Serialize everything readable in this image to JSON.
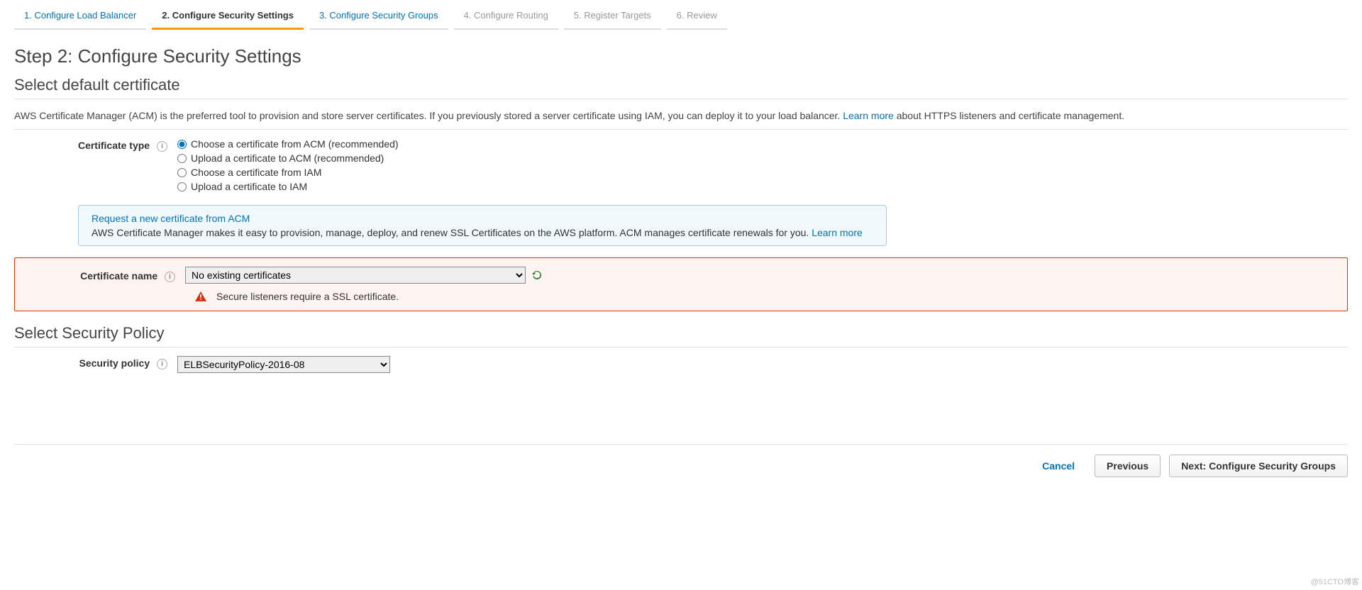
{
  "wizard": {
    "steps": [
      "1. Configure Load Balancer",
      "2. Configure Security Settings",
      "3. Configure Security Groups",
      "4. Configure Routing",
      "5. Register Targets",
      "6. Review"
    ]
  },
  "titles": {
    "page": "Step 2: Configure Security Settings",
    "section_cert": "Select default certificate",
    "section_policy": "Select Security Policy"
  },
  "cert_desc": {
    "text_a": "AWS Certificate Manager (ACM) is the preferred tool to provision and store server certificates. If you previously stored a server certificate using IAM, you can deploy it to your load balancer. ",
    "learn_more": "Learn more",
    "text_b": " about HTTPS listeners and certificate management."
  },
  "labels": {
    "certificate_type": "Certificate type",
    "certificate_name": "Certificate name",
    "security_policy": "Security policy"
  },
  "cert_type_options": [
    "Choose a certificate from ACM (recommended)",
    "Upload a certificate to ACM (recommended)",
    "Choose a certificate from IAM",
    "Upload a certificate to IAM"
  ],
  "info_box": {
    "link": "Request a new certificate from ACM",
    "text": "AWS Certificate Manager makes it easy to provision, manage, deploy, and renew SSL Certificates on the AWS platform. ACM manages certificate renewals for you. ",
    "learn_more": "Learn more"
  },
  "cert_name": {
    "selected": "No existing certificates",
    "error": "Secure listeners require a SSL certificate."
  },
  "security_policy": {
    "selected": "ELBSecurityPolicy-2016-08"
  },
  "footer": {
    "cancel": "Cancel",
    "previous": "Previous",
    "next": "Next: Configure Security Groups"
  },
  "watermark": "@51CTO博客"
}
